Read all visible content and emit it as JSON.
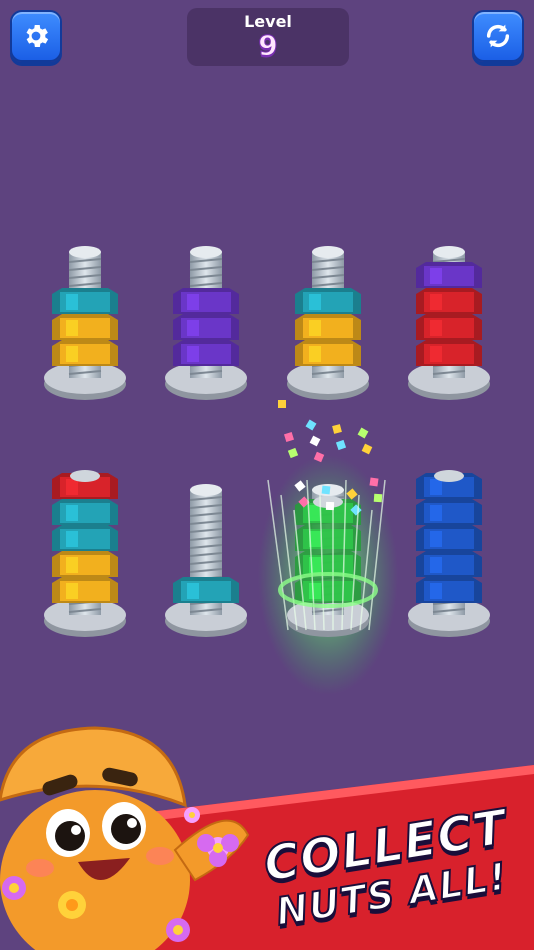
{
  "header": {
    "level_label": "Level",
    "level_value": "9",
    "settings_icon": "gear-icon",
    "restart_icon": "refresh-icon"
  },
  "bolts": [
    {
      "id": "bolt-1",
      "nuts": [
        "yellow",
        "yellow",
        "teal"
      ]
    },
    {
      "id": "bolt-2",
      "nuts": [
        "purple",
        "purple",
        "purple"
      ]
    },
    {
      "id": "bolt-3",
      "nuts": [
        "yellow",
        "yellow",
        "teal"
      ]
    },
    {
      "id": "bolt-4",
      "nuts": [
        "red",
        "red",
        "red",
        "purple"
      ]
    },
    {
      "id": "bolt-5",
      "nuts": [
        "yellow",
        "yellow",
        "teal",
        "teal",
        "red"
      ]
    },
    {
      "id": "bolt-6",
      "nuts": [
        "teal"
      ]
    },
    {
      "id": "bolt-7",
      "nuts": [
        "green",
        "green",
        "green",
        "green"
      ],
      "completed": true
    },
    {
      "id": "bolt-8",
      "nuts": [
        "blue",
        "blue",
        "blue",
        "blue",
        "blue"
      ]
    }
  ],
  "nut_colors": {
    "yellow": "#f2b01e",
    "teal": "#23a3b6",
    "purple": "#6a36c8",
    "red": "#d8232a",
    "blue": "#1f58c8",
    "green": "#2fc94a"
  },
  "banner": {
    "line1": "COLLECT",
    "line2": "NUTS ALL!",
    "color": "#d8212c",
    "mascot": "orange-nut-mascot"
  }
}
